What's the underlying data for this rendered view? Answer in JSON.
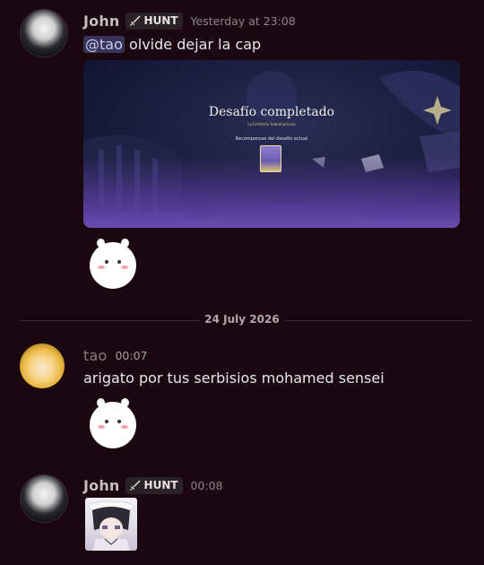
{
  "messages": [
    {
      "author": "John",
      "tag": "HUNT",
      "timestamp": "Yesterday at 23:08",
      "mention": "@tao",
      "text": "olvide dejar la cap",
      "embed": {
        "title": "Desafío completado",
        "subtitle": "La Ermitaña Sobrehumana",
        "rewards_label": "Recompensas del desafío actual"
      }
    },
    {
      "author": "tao",
      "timestamp": "00:07",
      "text": "arigato por tus serbisios mohamed sensei"
    },
    {
      "author": "John",
      "tag": "HUNT",
      "timestamp": "00:08"
    }
  ],
  "divider": {
    "date": "24 July 2026"
  },
  "colors": {
    "background": "#1a070f",
    "mention_bg": "#3a3257",
    "mention_text": "#c9cdfb",
    "tag_bg": "#2a2226"
  },
  "icons": [
    "sword-icon"
  ]
}
